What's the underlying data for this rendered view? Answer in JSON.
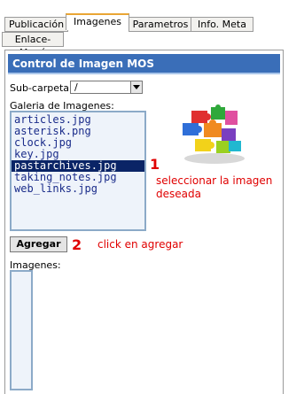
{
  "tabs": [
    {
      "label": "Publicación",
      "active": false
    },
    {
      "label": "Imagenes",
      "active": true
    },
    {
      "label": "Parametros",
      "active": false
    },
    {
      "label": "Info. Meta",
      "active": false
    },
    {
      "label": "Enlace-Menú",
      "active": false
    }
  ],
  "panel": {
    "title": "Control de Imagen MOS",
    "subfolder_label": "Sub-carpeta:",
    "subfolder_value": "/",
    "gallery_label": "Galeria de Imagenes:",
    "gallery_items": [
      "articles.jpg",
      "asterisk.png",
      "clock.jpg",
      "key.jpg",
      "pastarchives.jpg",
      "taking_notes.jpg",
      "web_links.jpg"
    ],
    "selected_item": "pastarchives.jpg",
    "add_button": "Agregar",
    "images_label": "Imagenes:"
  },
  "annotations": {
    "step1_number": "1",
    "step1_text": "seleccionar la imagen deseada",
    "step2_number": "2",
    "step2_text": "click en agregar"
  },
  "colors": {
    "header_bg": "#3a6eb8",
    "selected_bg": "#0a2466",
    "annotation": "#e00000",
    "active_tab_border": "#e9a534"
  },
  "icons": {
    "preview": "puzzle-pieces-preview"
  }
}
